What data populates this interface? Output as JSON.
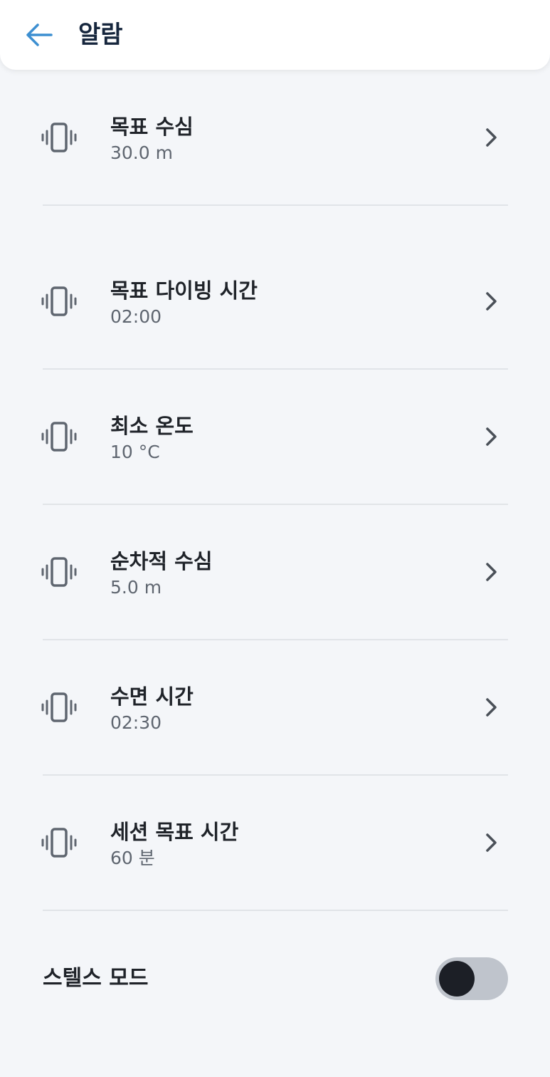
{
  "header": {
    "title": "알람",
    "back_icon": "arrow-left-icon"
  },
  "alarms": [
    {
      "label": "목표 수심",
      "value": "30.0 m",
      "icon": "vibration-icon"
    },
    {
      "label": "목표 다이빙 시간",
      "value": "02:00",
      "icon": "vibration-icon"
    },
    {
      "label": "최소 온도",
      "value": "10 °C",
      "icon": "vibration-icon"
    },
    {
      "label": "순차적 수심",
      "value": "5.0 m",
      "icon": "vibration-icon"
    },
    {
      "label": "수면 시간",
      "value": "02:30",
      "icon": "vibration-icon"
    },
    {
      "label": "세션 목표 시간",
      "value": "60 분",
      "icon": "vibration-icon"
    }
  ],
  "stealth_mode": {
    "label": "스텔스 모드",
    "enabled": false
  },
  "colors": {
    "accent": "#3d8fd1",
    "background": "#f4f6f9",
    "toggle_track": "#bfc4cc",
    "toggle_knob": "#1c1f26"
  }
}
